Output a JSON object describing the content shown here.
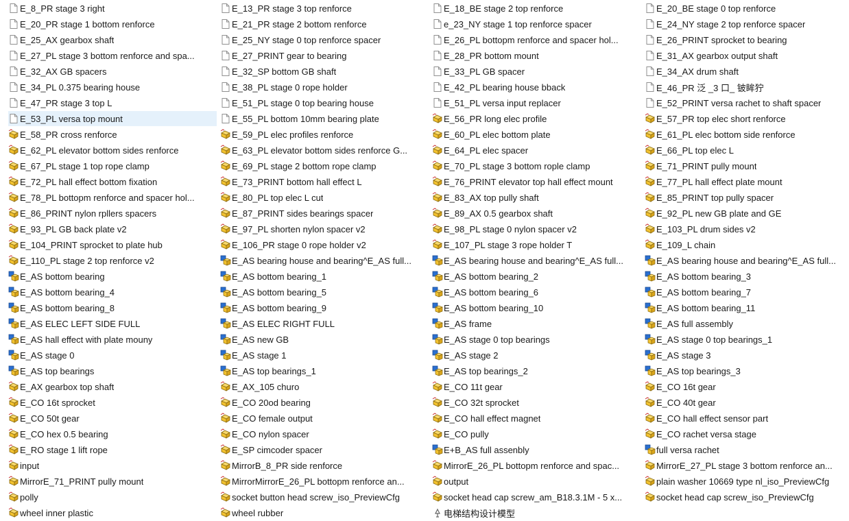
{
  "window": {
    "selected_index": 28,
    "accent_selection": "#e5f1fb"
  },
  "icon_colors": {
    "part_fill": "#f2c230",
    "part_stroke": "#8a6a10",
    "asm_blue": "#2a6fd0",
    "asm_yellow": "#f2c230",
    "doc_border": "#8f8f8f"
  },
  "files": [
    {
      "name": "E_8_PR stage 3 right",
      "icon": "doc-icon"
    },
    {
      "name": "E_13_PR stage 3 top renforce",
      "icon": "doc-icon"
    },
    {
      "name": "E_18_BE stage 2 top renforce",
      "icon": "doc-icon"
    },
    {
      "name": "E_20_BE stage 0 top renforce",
      "icon": "doc-icon"
    },
    {
      "name": "E_20_PR stage 1 bottom renforce",
      "icon": "doc-icon"
    },
    {
      "name": "E_21_PR stage 2 bottom renforce",
      "icon": "doc-icon"
    },
    {
      "name": "e_23_NY stage 1 top renforce spacer",
      "icon": "doc-icon"
    },
    {
      "name": "E_24_NY stage 2 top renforce spacer",
      "icon": "doc-icon"
    },
    {
      "name": "E_25_AX gearbox shaft",
      "icon": "doc-icon"
    },
    {
      "name": "E_25_NY stage 0 top renforce spacer",
      "icon": "doc-icon"
    },
    {
      "name": "E_26_PL bottopm renforce and spacer hol...",
      "icon": "doc-icon"
    },
    {
      "name": "E_26_PRINT sprocket to bearing",
      "icon": "doc-icon"
    },
    {
      "name": "E_27_PL stage 3 bottom renforce and spa...",
      "icon": "doc-icon"
    },
    {
      "name": "E_27_PRINT gear to bearing",
      "icon": "doc-icon"
    },
    {
      "name": "E_28_PR bottom mount",
      "icon": "doc-icon"
    },
    {
      "name": "E_31_AX gearbox output shaft",
      "icon": "doc-icon"
    },
    {
      "name": "E_32_AX GB spacers",
      "icon": "doc-icon"
    },
    {
      "name": "E_32_SP bottom GB shaft",
      "icon": "doc-icon"
    },
    {
      "name": "E_33_PL GB spacer",
      "icon": "doc-icon"
    },
    {
      "name": "E_34_AX drum shaft",
      "icon": "doc-icon"
    },
    {
      "name": "E_34_PL 0.375 bearing house",
      "icon": "doc-icon"
    },
    {
      "name": "E_38_PL stage 0 rope holder",
      "icon": "doc-icon"
    },
    {
      "name": "E_42_PL bearing house bback",
      "icon": "doc-icon"
    },
    {
      "name": "E_46_PR 泛   _3 口_   铍眸狞",
      "icon": "doc-icon"
    },
    {
      "name": "E_47_PR stage 3 top L",
      "icon": "doc-icon"
    },
    {
      "name": "E_51_PL stage 0 top bearing house",
      "icon": "doc-icon"
    },
    {
      "name": "E_51_PL versa input replacer",
      "icon": "doc-icon"
    },
    {
      "name": "E_52_PRINT versa rachet to shaft spacer",
      "icon": "doc-icon"
    },
    {
      "name": "E_53_PL versa top mount",
      "icon": "doc-icon"
    },
    {
      "name": "E_55_PL bottom 10mm bearing plate",
      "icon": "doc-icon"
    },
    {
      "name": "E_56_PR long elec profile",
      "icon": "part-icon"
    },
    {
      "name": "E_57_PR top elec short renforce",
      "icon": "part-icon"
    },
    {
      "name": "E_58_PR cross renforce",
      "icon": "part-icon"
    },
    {
      "name": "E_59_PL elec profiles renforce",
      "icon": "part-icon"
    },
    {
      "name": "E_60_PL elec bottom plate",
      "icon": "part-icon"
    },
    {
      "name": "E_61_PL elec bottom side renforce",
      "icon": "part-icon"
    },
    {
      "name": "E_62_PL elevator bottom sides renforce",
      "icon": "part-icon"
    },
    {
      "name": "E_63_PL elevator bottom sides renforce G...",
      "icon": "part-icon"
    },
    {
      "name": "E_64_PL elec spacer",
      "icon": "part-icon"
    },
    {
      "name": "E_66_PL top elec L",
      "icon": "part-icon"
    },
    {
      "name": "E_67_PL stage 1 top rope clamp",
      "icon": "part-icon"
    },
    {
      "name": "E_69_PL stage 2 bottom rope clamp",
      "icon": "part-icon"
    },
    {
      "name": "E_70_PL stage 3 bottom rople clamp",
      "icon": "part-icon"
    },
    {
      "name": "E_71_PRINT pully mount",
      "icon": "part-icon"
    },
    {
      "name": "E_72_PL hall effect bottom fixation",
      "icon": "part-icon"
    },
    {
      "name": "E_73_PRINT bottom hall effect L",
      "icon": "part-icon"
    },
    {
      "name": "E_76_PRINT elevator top hall effect mount",
      "icon": "part-icon"
    },
    {
      "name": "E_77_PL hall effect plate mount",
      "icon": "part-icon"
    },
    {
      "name": "E_78_PL bottopm renforce and spacer hol...",
      "icon": "part-icon"
    },
    {
      "name": "E_80_PL top elec L cut",
      "icon": "part-icon"
    },
    {
      "name": "E_83_AX top pully shaft",
      "icon": "part-icon"
    },
    {
      "name": "E_85_PRINT top pully spacer",
      "icon": "part-icon"
    },
    {
      "name": "E_86_PRINT nylon rpllers spacers",
      "icon": "part-icon"
    },
    {
      "name": "E_87_PRINT sides bearings spacer",
      "icon": "part-icon"
    },
    {
      "name": "E_89_AX 0.5 gearbox shaft",
      "icon": "part-icon"
    },
    {
      "name": "E_92_PL new GB plate and GE",
      "icon": "part-icon"
    },
    {
      "name": "E_93_PL GB back plate v2",
      "icon": "part-icon"
    },
    {
      "name": "E_97_PL shorten nylon spacer v2",
      "icon": "part-icon"
    },
    {
      "name": "E_98_PL stage 0 nylon spacer v2",
      "icon": "part-icon"
    },
    {
      "name": "E_103_PL drum sides v2",
      "icon": "part-icon"
    },
    {
      "name": "E_104_PRINT sprocket to plate hub",
      "icon": "part-icon"
    },
    {
      "name": "E_106_PR stage 0 rope holder v2",
      "icon": "part-icon"
    },
    {
      "name": "E_107_PL stage 3 rope holder T",
      "icon": "part-icon"
    },
    {
      "name": "E_109_L chain",
      "icon": "part-icon"
    },
    {
      "name": "E_110_PL stage 2 top renforce v2",
      "icon": "part-icon"
    },
    {
      "name": "E_AS bearing house and bearing^E_AS full...",
      "icon": "assembly-icon"
    },
    {
      "name": "E_AS bearing house and bearing^E_AS full...",
      "icon": "assembly-icon"
    },
    {
      "name": "E_AS bearing house and bearing^E_AS full...",
      "icon": "assembly-icon"
    },
    {
      "name": "E_AS bottom bearing",
      "icon": "assembly-icon"
    },
    {
      "name": "E_AS bottom bearing_1",
      "icon": "assembly-icon"
    },
    {
      "name": "E_AS bottom bearing_2",
      "icon": "assembly-icon"
    },
    {
      "name": "E_AS bottom bearing_3",
      "icon": "assembly-icon"
    },
    {
      "name": "E_AS bottom bearing_4",
      "icon": "assembly-icon"
    },
    {
      "name": "E_AS bottom bearing_5",
      "icon": "assembly-icon"
    },
    {
      "name": "E_AS bottom bearing_6",
      "icon": "assembly-icon"
    },
    {
      "name": "E_AS bottom bearing_7",
      "icon": "assembly-icon"
    },
    {
      "name": "E_AS bottom bearing_8",
      "icon": "assembly-icon"
    },
    {
      "name": "E_AS bottom bearing_9",
      "icon": "assembly-icon"
    },
    {
      "name": "E_AS bottom bearing_10",
      "icon": "assembly-icon"
    },
    {
      "name": "E_AS bottom bearing_11",
      "icon": "assembly-icon"
    },
    {
      "name": "E_AS ELEC LEFT SIDE FULL",
      "icon": "assembly-icon"
    },
    {
      "name": "E_AS ELEC RIGHT FULL",
      "icon": "assembly-icon"
    },
    {
      "name": "E_AS frame",
      "icon": "assembly-icon"
    },
    {
      "name": "E_AS full assembly",
      "icon": "assembly-icon"
    },
    {
      "name": "E_AS hall effect with plate mouny",
      "icon": "assembly-icon"
    },
    {
      "name": "E_AS new GB",
      "icon": "assembly-icon"
    },
    {
      "name": "E_AS stage 0 top bearings",
      "icon": "assembly-icon"
    },
    {
      "name": "E_AS stage 0 top bearings_1",
      "icon": "assembly-icon"
    },
    {
      "name": "E_AS stage 0",
      "icon": "assembly-icon"
    },
    {
      "name": "E_AS stage 1",
      "icon": "assembly-icon"
    },
    {
      "name": "E_AS stage 2",
      "icon": "assembly-icon"
    },
    {
      "name": "E_AS stage 3",
      "icon": "assembly-icon"
    },
    {
      "name": "E_AS top bearings",
      "icon": "assembly-icon"
    },
    {
      "name": "E_AS top bearings_1",
      "icon": "assembly-icon"
    },
    {
      "name": "E_AS top bearings_2",
      "icon": "assembly-icon"
    },
    {
      "name": "E_AS top bearings_3",
      "icon": "assembly-icon"
    },
    {
      "name": "E_AX gearbox top shaft",
      "icon": "part-icon"
    },
    {
      "name": "E_AX_105 churo",
      "icon": "part-icon"
    },
    {
      "name": "E_CO 11t gear",
      "icon": "part-icon"
    },
    {
      "name": "E_CO 16t gear",
      "icon": "part-icon"
    },
    {
      "name": "E_CO 16t sprocket",
      "icon": "part-icon"
    },
    {
      "name": "E_CO 20od bearing",
      "icon": "part-icon"
    },
    {
      "name": "E_CO 32t sprocket",
      "icon": "part-icon"
    },
    {
      "name": "E_CO 40t gear",
      "icon": "part-icon"
    },
    {
      "name": "E_CO 50t gear",
      "icon": "part-icon"
    },
    {
      "name": "E_CO female output",
      "icon": "part-icon"
    },
    {
      "name": "E_CO hall effect magnet",
      "icon": "part-icon"
    },
    {
      "name": "E_CO hall effect sensor part",
      "icon": "part-icon"
    },
    {
      "name": "E_CO hex 0.5 bearing",
      "icon": "part-icon"
    },
    {
      "name": "E_CO nylon spacer",
      "icon": "part-icon"
    },
    {
      "name": "E_CO pully",
      "icon": "part-icon"
    },
    {
      "name": "E_CO rachet versa stage",
      "icon": "part-icon"
    },
    {
      "name": "E_RO stage 1 lift rope",
      "icon": "part-icon"
    },
    {
      "name": "E_SP cimcoder spacer",
      "icon": "part-icon"
    },
    {
      "name": "E+B_AS full assenbly",
      "icon": "assembly-icon"
    },
    {
      "name": "full versa rachet",
      "icon": "assembly-icon"
    },
    {
      "name": "input",
      "icon": "part-icon"
    },
    {
      "name": "MirrorB_8_PR side renforce",
      "icon": "part-icon"
    },
    {
      "name": "MirrorE_26_PL bottopm renforce and spac...",
      "icon": "part-icon"
    },
    {
      "name": "MirrorE_27_PL stage 3 bottom renforce an...",
      "icon": "part-icon"
    },
    {
      "name": "MirrorE_71_PRINT pully mount",
      "icon": "part-icon"
    },
    {
      "name": "MirrorMirrorE_26_PL bottopm renforce an...",
      "icon": "part-icon"
    },
    {
      "name": "output",
      "icon": "part-icon"
    },
    {
      "name": "plain washer 10669 type nl_iso_PreviewCfg",
      "icon": "part-icon"
    },
    {
      "name": "polly",
      "icon": "part-icon"
    },
    {
      "name": "socket button head screw_iso_PreviewCfg",
      "icon": "part-icon"
    },
    {
      "name": "socket head cap screw_am_B18.3.1M - 5 x...",
      "icon": "part-icon"
    },
    {
      "name": "socket head cap screw_iso_PreviewCfg",
      "icon": "part-icon"
    },
    {
      "name": "wheel inner plastic",
      "icon": "part-icon"
    },
    {
      "name": "wheel rubber",
      "icon": "part-icon"
    },
    {
      "name": "电梯结构设计模型",
      "icon": "drawing-icon"
    }
  ]
}
